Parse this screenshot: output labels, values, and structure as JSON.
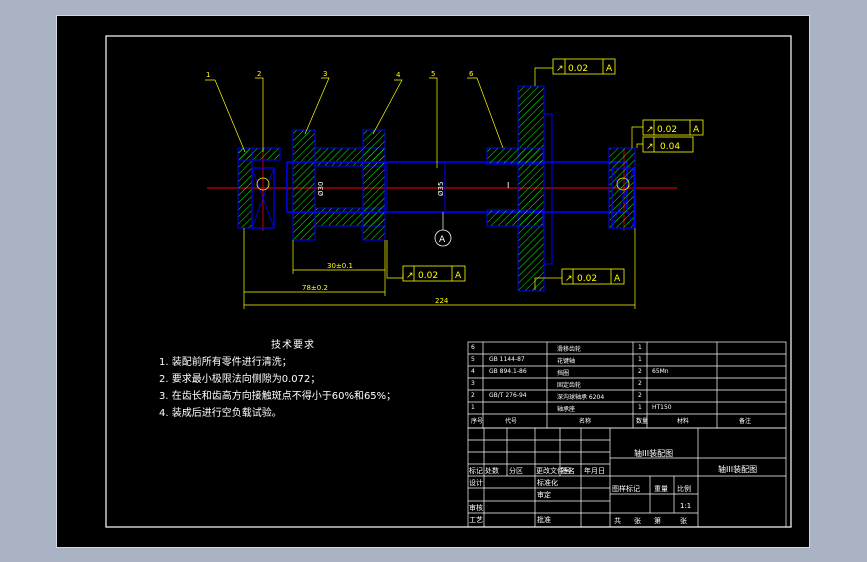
{
  "drawing": {
    "balloons": [
      "1",
      "2",
      "3",
      "4",
      "5",
      "6"
    ],
    "dimensions": {
      "d1": "30±0.1",
      "d2": "78±0.2",
      "d3": "224",
      "dia1": "Ø30",
      "dia2": "Ø35",
      "len": "I"
    },
    "tolerances": [
      {
        "symbol": "↗",
        "value": "0.02",
        "datum": "A"
      },
      {
        "symbol": "↗",
        "value": "0.02",
        "datum": "A"
      },
      {
        "symbol": "↗",
        "value": "0.04",
        "datum": ""
      },
      {
        "symbol": "↗",
        "value": "0.02",
        "datum": "A"
      },
      {
        "symbol": "↗",
        "value": "0.02",
        "datum": "A"
      }
    ],
    "datum": "A"
  },
  "notes": {
    "title": "技术要求",
    "items": [
      "1. 装配前所有零件进行清洗；",
      "2. 要求最小极限法向侧隙为0.072；",
      "3. 在齿长和齿高方向接触斑点不得小于60%和65%；",
      "4. 装成后进行空负载试验。"
    ]
  },
  "bom": {
    "rows": [
      {
        "no": "6",
        "code": "",
        "name": "滑移齿轮",
        "qty": "1",
        "material": "",
        "note": ""
      },
      {
        "no": "5",
        "code": "GB 1144-87",
        "name": "花键轴",
        "qty": "1",
        "material": "",
        "note": ""
      },
      {
        "no": "4",
        "code": "GB 894.1-86",
        "name": "挡圈",
        "qty": "2",
        "material": "65Mn",
        "note": ""
      },
      {
        "no": "3",
        "code": "",
        "name": "固定齿轮",
        "qty": "2",
        "material": "",
        "note": ""
      },
      {
        "no": "2",
        "code": "GB/T 276-94",
        "name": "深沟球轴承 6204",
        "qty": "2",
        "material": "",
        "note": ""
      },
      {
        "no": "1",
        "code": "",
        "name": "轴承座",
        "qty": "1",
        "material": "HT150",
        "note": ""
      }
    ],
    "header": {
      "no": "序号",
      "code": "代号",
      "name": "名称",
      "qty": "数量",
      "material": "材料",
      "note": "备注"
    }
  },
  "titleblock": {
    "drawing_name": "轴III装配图",
    "drawing_name2": "轴III装配图",
    "labels": {
      "mark": "标记",
      "count": "处数",
      "zone": "分区",
      "doc": "更改文件号",
      "sign": "签名",
      "date": "年月日",
      "design": "设计",
      "std": "标准化",
      "review": "审核",
      "process": "工艺",
      "check": "审定",
      "approve": "批准",
      "stage": "图样标记",
      "weight": "重量",
      "scale": "比例",
      "scale_val": "1:1",
      "sheets": "共",
      "sheet_unit": "张",
      "page": "第",
      "page_unit": "张"
    }
  },
  "colors": {
    "frame": "#ffffff",
    "part": "#0000ff",
    "hatch": "#00ff00",
    "center": "#ff0000",
    "dim": "#ffff00",
    "leader": "#ffff00",
    "text": "#ffffff"
  }
}
